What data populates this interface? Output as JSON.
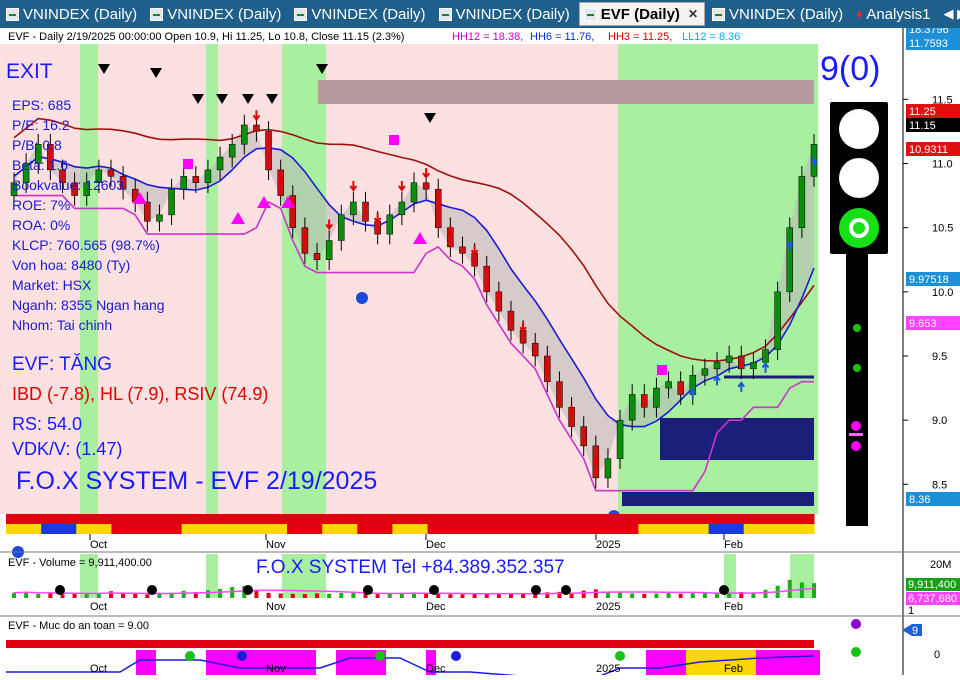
{
  "tabs": [
    {
      "label": "VNINDEX (Daily)",
      "active": false
    },
    {
      "label": "VNINDEX (Daily)",
      "active": false
    },
    {
      "label": "VNINDEX (Daily)",
      "active": false
    },
    {
      "label": "VNINDEX (Daily)",
      "active": false
    },
    {
      "label": "EVF (Daily)",
      "active": true
    },
    {
      "label": "VNINDEX (Daily)",
      "active": false
    },
    {
      "label": "Analysis1",
      "active": false
    }
  ],
  "price_panel": {
    "header": "EVF - Daily 2/19/2025 00:00:00 Open 10.9, Hi 11.25, Lo 10.8, Close 11.15 (2.3%)",
    "hh12": "HH12 = 18.38,",
    "hh6": "HH6 = 11.76,",
    "hh3": "HH3 = 11.25,",
    "ll12": "LL12 = 8.36",
    "signal": "EXIT",
    "count_label": "9(0)",
    "fundamentals": [
      "EPS: 685",
      "P/E: 16.2",
      "P/B: 0.8",
      "Beta: 1.6",
      "Bookvalue: 12603",
      "ROE: 7%",
      "ROA: 0%",
      "KLCP: 760.565 (98.7%)",
      "Von hoa: 8480 (Ty)",
      "Market: HSX",
      "Nganh: 8355 Ngan hang",
      "Nhom: Tai chinh"
    ],
    "status": "EVF: TĂNG",
    "ibd": "IBD (-7.8), HL (7.9), RSIV (74.9)",
    "rs": "RS: 54.0",
    "vdk": "VDK/V:  (1.47)",
    "system_label": "F.O.X SYSTEM - EVF 2/19/2025"
  },
  "price_axis": {
    "ticks": [
      "11.5",
      "11.0",
      "10.5",
      "10.0",
      "9.5",
      "9.0",
      "8.5"
    ],
    "badges": [
      {
        "text": "18.3796",
        "bg": "#1c8fd6",
        "fg": "#ffffff"
      },
      {
        "text": "11.7593",
        "bg": "#1c8fd6",
        "fg": "#ffffff"
      },
      {
        "text": "11.25",
        "bg": "#e01010",
        "fg": "#ffffff"
      },
      {
        "text": "11.15",
        "bg": "#000000",
        "fg": "#ffffff"
      },
      {
        "text": "10.9311",
        "bg": "#e01010",
        "fg": "#ffffff"
      },
      {
        "text": "9.97518",
        "bg": "#1c8fd6",
        "fg": "#ffffff"
      },
      {
        "text": "9.653",
        "bg": "#ff44ff",
        "fg": "#ffffff"
      },
      {
        "text": "8.36",
        "bg": "#1c8fd6",
        "fg": "#ffffff"
      }
    ]
  },
  "x_axis": {
    "labels": [
      "Oct",
      "Nov",
      "Dec",
      "2025",
      "Feb"
    ]
  },
  "volume_panel": {
    "header": "EVF - Volume = 9,911,400.00",
    "banner": "F.O.X SYSTEM Tel +84.389.352.357",
    "ticks": [
      "20M"
    ],
    "badges": [
      {
        "text": "9,911,400",
        "bg": "#18a018",
        "fg": "#ffffff"
      },
      {
        "text": "6,737,680",
        "bg": "#ff44ff",
        "fg": "#ffffff"
      }
    ],
    "bottom_tick": "1"
  },
  "safety_panel": {
    "header": "EVF - Muc do an toan = 9.00",
    "badge": {
      "text": "9",
      "bg": "#1c5fd6",
      "fg": "#ffffff"
    },
    "ticks": [
      "0"
    ]
  },
  "chart_data": {
    "type": "candlestick",
    "title": "EVF - Daily 2/19/2025",
    "x_labels": [
      "Oct",
      "Nov",
      "Dec",
      "2025",
      "Feb"
    ],
    "ylim": [
      8.3,
      11.9
    ],
    "last_bar": {
      "date": "2/19/2025",
      "open": 10.9,
      "high": 11.25,
      "low": 10.8,
      "close": 11.15,
      "change_pct": 2.3
    },
    "close": [
      10.85,
      11.0,
      11.15,
      10.95,
      10.85,
      10.75,
      10.85,
      10.95,
      10.9,
      10.8,
      10.7,
      10.55,
      10.6,
      10.8,
      10.9,
      10.85,
      10.95,
      11.05,
      11.15,
      11.3,
      11.25,
      10.95,
      10.75,
      10.5,
      10.3,
      10.25,
      10.4,
      10.6,
      10.7,
      10.55,
      10.45,
      10.6,
      10.7,
      10.85,
      10.8,
      10.5,
      10.35,
      10.3,
      10.2,
      10.0,
      9.85,
      9.7,
      9.6,
      9.5,
      9.3,
      9.1,
      8.95,
      8.8,
      8.55,
      8.7,
      9.0,
      9.2,
      9.1,
      9.25,
      9.3,
      9.2,
      9.35,
      9.4,
      9.45,
      9.5,
      9.4,
      9.45,
      9.55,
      10.0,
      10.5,
      10.9,
      11.15
    ],
    "volume": [
      3.5,
      4.2,
      2.8,
      3.1,
      2.5,
      3.0,
      2.6,
      2.9,
      4.5,
      3.2,
      2.7,
      2.4,
      2.9,
      3.6,
      4.8,
      3.9,
      5.2,
      6.1,
      7.3,
      8.0,
      5.5,
      3.4,
      3.0,
      2.8,
      2.6,
      3.1,
      2.9,
      3.3,
      4.0,
      3.2,
      2.6,
      2.9,
      3.1,
      3.8,
      3.0,
      2.7,
      2.5,
      2.4,
      2.6,
      2.8,
      3.2,
      2.9,
      3.0,
      3.4,
      3.8,
      4.1,
      3.6,
      4.9,
      5.8,
      4.2,
      3.9,
      3.1,
      2.8,
      3.0,
      3.3,
      2.9,
      3.2,
      3.4,
      3.0,
      3.6,
      4.0,
      3.8,
      5.5,
      8.2,
      12.1,
      10.4,
      9.9
    ],
    "series": [
      {
        "name": "HH12",
        "values": [
          18.38
        ]
      },
      {
        "name": "HH6",
        "values": [
          11.76
        ]
      },
      {
        "name": "HH3",
        "values": [
          11.25
        ]
      },
      {
        "name": "LL12",
        "values": [
          8.36
        ]
      }
    ]
  },
  "colors": {
    "bull": "#0a8f0a",
    "bear": "#d01010",
    "green_band": "#a8f0a0",
    "pink_band": "#fde0e0",
    "navy": "#1b1f7a",
    "cyan": "#3ee6f0"
  }
}
